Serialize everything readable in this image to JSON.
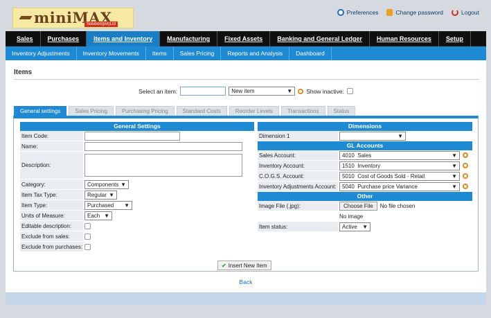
{
  "logo": {
    "name": "miniMAX",
    "tag": "Solution(pvt)Ltd"
  },
  "toplinks": {
    "preferences": "Preferences",
    "change_password": "Change password",
    "logout": "Logout"
  },
  "main_menu": [
    "Sales",
    "Purchases",
    "Items and Inventory",
    "Manufacturing",
    "Fixed Assets",
    "Banking and General Ledger",
    "Human Resources",
    "Setup"
  ],
  "sub_menu": [
    "Inventory Adjustments",
    "Inventory Movements",
    "Items",
    "Sales Pricing",
    "Reports and Analysis",
    "Dashboard"
  ],
  "page_title": "Items",
  "select_row": {
    "label": "Select an item:",
    "item_value": "New item",
    "show_inactive": "Show inactive:"
  },
  "tabs": [
    "General settings",
    "Sales Pricing",
    "Purchasing Pricing",
    "Standard Costs",
    "Reorder Levels",
    "Transactions",
    "Status"
  ],
  "general": {
    "title": "General Settings",
    "item_code": "Item Code:",
    "name": "Name:",
    "description": "Description:",
    "category": "Category:",
    "category_value": "Components",
    "tax_type": "Item Tax Type:",
    "tax_value": "Regular",
    "item_type": "Item Type:",
    "item_type_value": "Purchased",
    "uom": "Units of Measure:",
    "uom_value": "Each",
    "editable": "Editable description:",
    "exclude_sales": "Exclude from sales:",
    "exclude_purchases": "Exclude from purchases:"
  },
  "dimensions": {
    "title": "Dimensions",
    "dim1": "Dimension 1",
    "dim1_value": ""
  },
  "gl": {
    "title": "GL Accounts",
    "sales": "Sales Account:",
    "sales_code": "4010",
    "sales_name": "Sales",
    "inventory": "Inventory Account:",
    "inventory_code": "1510",
    "inventory_name": "Inventory",
    "cogs": "C.O.G.S. Account:",
    "cogs_code": "5010",
    "cogs_name": "Cost of Goods Sold - Retail",
    "adj": "Inventory Adjustments Account:",
    "adj_code": "5040",
    "adj_name": "Purchase price Variance"
  },
  "other": {
    "title": "Other",
    "image_file": "Image File (.jpg):",
    "choose": "Choose File",
    "no_file": "No file chosen",
    "no_image": "No image",
    "status": "Item status:",
    "status_value": "Active"
  },
  "actions": {
    "insert": "Insert New Item",
    "back": "Back"
  }
}
